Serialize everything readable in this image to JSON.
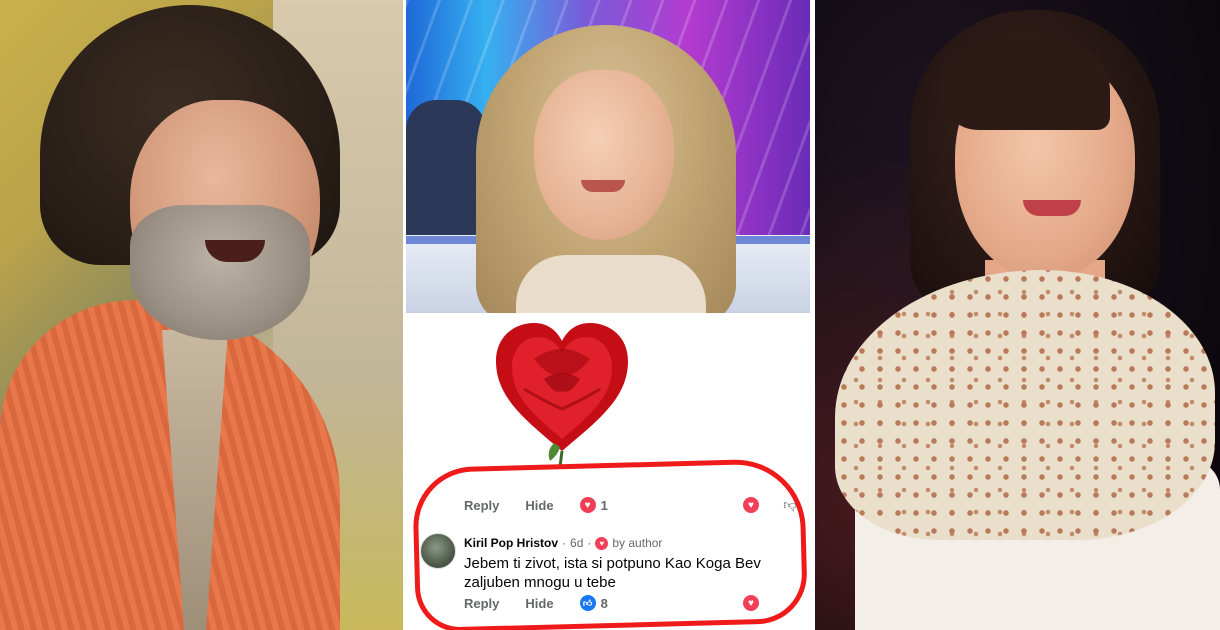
{
  "comment": {
    "top_actions": {
      "reply": "Reply",
      "hide": "Hide",
      "reaction_count": "1"
    },
    "author": "Kiril Pop Hristov",
    "time": "6d",
    "by_author": "by author",
    "text": "Jebem ti zivot, ista si potpuno Kao Koga Bev zaljuben mnogu u tebe",
    "actions": {
      "reply": "Reply",
      "hide": "Hide",
      "like_count": "8"
    }
  },
  "colors": {
    "highlight_ring": "#ef1b1b",
    "heart_reaction": "#f33e58",
    "like_reaction": "#1877f2"
  },
  "icons": [
    "rose-heart-image",
    "heart-reaction-icon",
    "like-reaction-icon",
    "dislike-icon"
  ]
}
